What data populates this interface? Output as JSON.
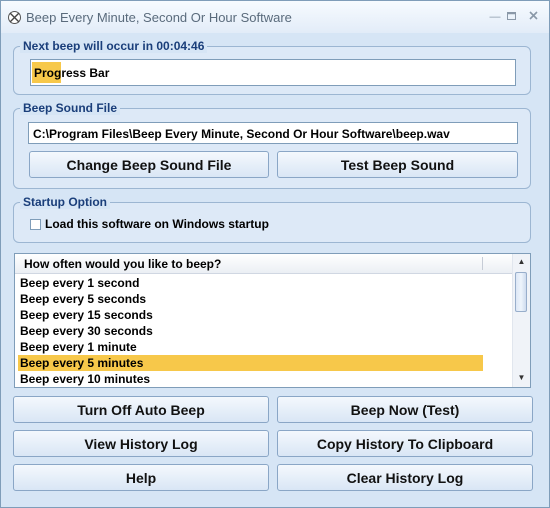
{
  "window": {
    "title": "Beep Every Minute, Second Or Hour Software"
  },
  "next_beep": {
    "group_label": "Next beep will occur in 00:04:46",
    "progress_text": "Progress Bar",
    "progress_fraction": 0.06
  },
  "sound_file": {
    "group_label": "Beep Sound File",
    "path": "C:\\Program Files\\Beep Every Minute, Second Or Hour Software\\beep.wav",
    "change_label": "Change Beep Sound File",
    "test_label": "Test Beep Sound"
  },
  "startup": {
    "group_label": "Startup Option",
    "checkbox_label": "Load this software on Windows startup",
    "checked": false
  },
  "interval_list": {
    "header": "How often would you like to beep?",
    "items": [
      "Beep every 1 second",
      "Beep every 5 seconds",
      "Beep every 15 seconds",
      "Beep every 30 seconds",
      "Beep every 1 minute",
      "Beep every 5 minutes",
      "Beep every 10 minutes"
    ],
    "selected_index": 5
  },
  "buttons": {
    "turn_off": "Turn Off Auto Beep",
    "beep_now": "Beep Now (Test)",
    "view_history": "View History Log",
    "copy_history": "Copy History To Clipboard",
    "help": "Help",
    "clear_history": "Clear History Log"
  },
  "colors": {
    "accent": "#f7c84a",
    "group_title": "#1a3e7a",
    "window_bg": "#d6e5f5"
  }
}
